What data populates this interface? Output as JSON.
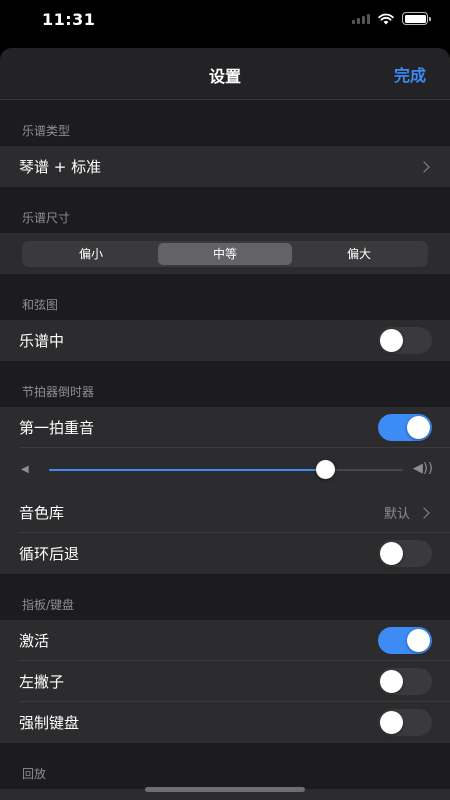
{
  "status_bar": {
    "time": "11:31"
  },
  "nav": {
    "title": "设置",
    "done_label": "完成"
  },
  "sections": {
    "score_type": {
      "header": "乐谱类型",
      "row_label": "琴谱 + 标准"
    },
    "score_size": {
      "header": "乐谱尺寸",
      "segments": [
        "偏小",
        "中等",
        "偏大"
      ],
      "selected": "中等"
    },
    "chord": {
      "header": "和弦图",
      "row_label": "乐谱中",
      "toggle_on": false
    },
    "metronome": {
      "header": "节拍器倒时器",
      "accent_label": "第一拍重音",
      "accent_on": true,
      "volume_level": 0.78,
      "volume_low_icon": "volume-low-icon",
      "volume_high_icon": "volume-high-icon",
      "sound_label": "音色库",
      "sound_value": "默认",
      "loop_label": "循环后退",
      "loop_on": false
    },
    "fretboard": {
      "header": "指板/键盘",
      "activate_label": "激活",
      "activate_on": true,
      "lefty_label": "左撇子",
      "lefty_on": false,
      "force_keyboard_label": "强制键盘",
      "force_keyboard_on": false
    },
    "playback": {
      "header": "回放"
    }
  },
  "colors": {
    "accent": "#3d8bf5",
    "background": "#1c1c1e",
    "row": "#2c2c2e"
  }
}
